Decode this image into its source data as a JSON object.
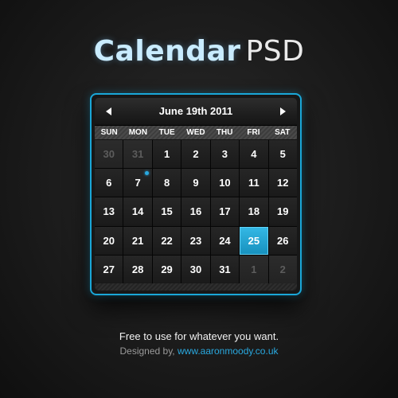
{
  "title": {
    "part1": "Calendar",
    "part2": "PSD"
  },
  "calendar": {
    "month_label": "June 19th 2011",
    "prev_icon": "triangle-left-icon",
    "next_icon": "triangle-right-icon",
    "weekdays": [
      "SUN",
      "MON",
      "TUE",
      "WED",
      "THU",
      "FRI",
      "SAT"
    ],
    "days": [
      {
        "n": "30",
        "muted": true
      },
      {
        "n": "31",
        "muted": true
      },
      {
        "n": "1"
      },
      {
        "n": "2"
      },
      {
        "n": "3"
      },
      {
        "n": "4"
      },
      {
        "n": "5"
      },
      {
        "n": "6"
      },
      {
        "n": "7",
        "event": true
      },
      {
        "n": "8"
      },
      {
        "n": "9"
      },
      {
        "n": "10"
      },
      {
        "n": "11"
      },
      {
        "n": "12"
      },
      {
        "n": "13"
      },
      {
        "n": "14"
      },
      {
        "n": "15"
      },
      {
        "n": "16"
      },
      {
        "n": "17"
      },
      {
        "n": "18"
      },
      {
        "n": "19"
      },
      {
        "n": "20"
      },
      {
        "n": "21"
      },
      {
        "n": "22"
      },
      {
        "n": "23"
      },
      {
        "n": "24"
      },
      {
        "n": "25",
        "today": true
      },
      {
        "n": "26"
      },
      {
        "n": "27"
      },
      {
        "n": "28"
      },
      {
        "n": "29"
      },
      {
        "n": "30"
      },
      {
        "n": "31"
      },
      {
        "n": "1",
        "muted": true
      },
      {
        "n": "2",
        "muted": true
      }
    ],
    "accent_color": "#1aa7d8"
  },
  "footer": {
    "tagline": "Free to use for whatever you want.",
    "designed_by": "Designed by, ",
    "link": "www.aaronmoody.co.uk"
  }
}
